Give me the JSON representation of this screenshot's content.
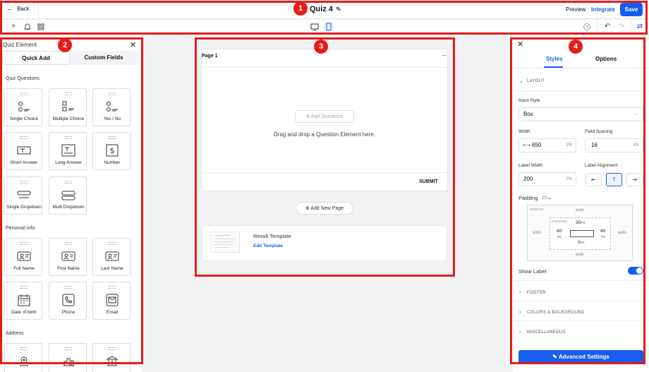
{
  "header": {
    "back_label": "Back",
    "title": "Quiz 4",
    "preview_label": "Preview",
    "integrate_label": "Integrate",
    "save_label": "Save"
  },
  "left_panel": {
    "heading": "Quiz Element",
    "tabs": [
      "Quick Add",
      "Custom Fields"
    ],
    "sections": {
      "quiz_questions": "Quiz Questions",
      "personal_info": "Personal Info",
      "address": "Address"
    },
    "quiz_items": [
      "Single Choice",
      "Multiple Choice",
      "Yes / No",
      "Short Answer",
      "Long Answer",
      "Number",
      "Single Dropdown",
      "Multi Dropdown"
    ],
    "personal_items": [
      "Full Name",
      "First Name",
      "Last Name",
      "Date of birth",
      "Phone",
      "Email"
    ]
  },
  "canvas": {
    "page_label": "Page 1",
    "more_icon": "···",
    "add_questions": "Add Questions",
    "drag_text": "Drag and drop a Question Element here.",
    "submit": "SUBMIT",
    "add_page": "Add New Page",
    "result_title": "Result Template",
    "edit_template": "Edit Template"
  },
  "right_panel": {
    "tabs": [
      "Styles",
      "Options"
    ],
    "layout_label": "LAYOUT",
    "input_style_label": "Input Style",
    "input_style_value": "Box",
    "width_label": "Width",
    "width_value": "650",
    "field_spacing_label": "Field Spacing",
    "field_spacing_value": "16",
    "label_width_label": "Label Width",
    "label_width_value": "200",
    "label_alignment_label": "Label Alignment",
    "unit": "PX",
    "padding_label": "Padding",
    "margin_label": "MARGIN",
    "padding_inner_label": "PADDING",
    "auto": "auto",
    "pad_top": "30",
    "pad_left": "40",
    "pad_right": "40",
    "pad_bottom": "0",
    "show_label": "Show Label",
    "show_label_on": true,
    "footer_label": "FOOTER",
    "colors_label": "COLORS & BACKGROUND",
    "misc_label": "MISCELLANEOUS",
    "advanced_label": "Advanced Settings"
  },
  "annotations": [
    "1",
    "2",
    "3",
    "4"
  ],
  "colors": {
    "accent": "#155eef",
    "highlight": "#e61c1c"
  }
}
